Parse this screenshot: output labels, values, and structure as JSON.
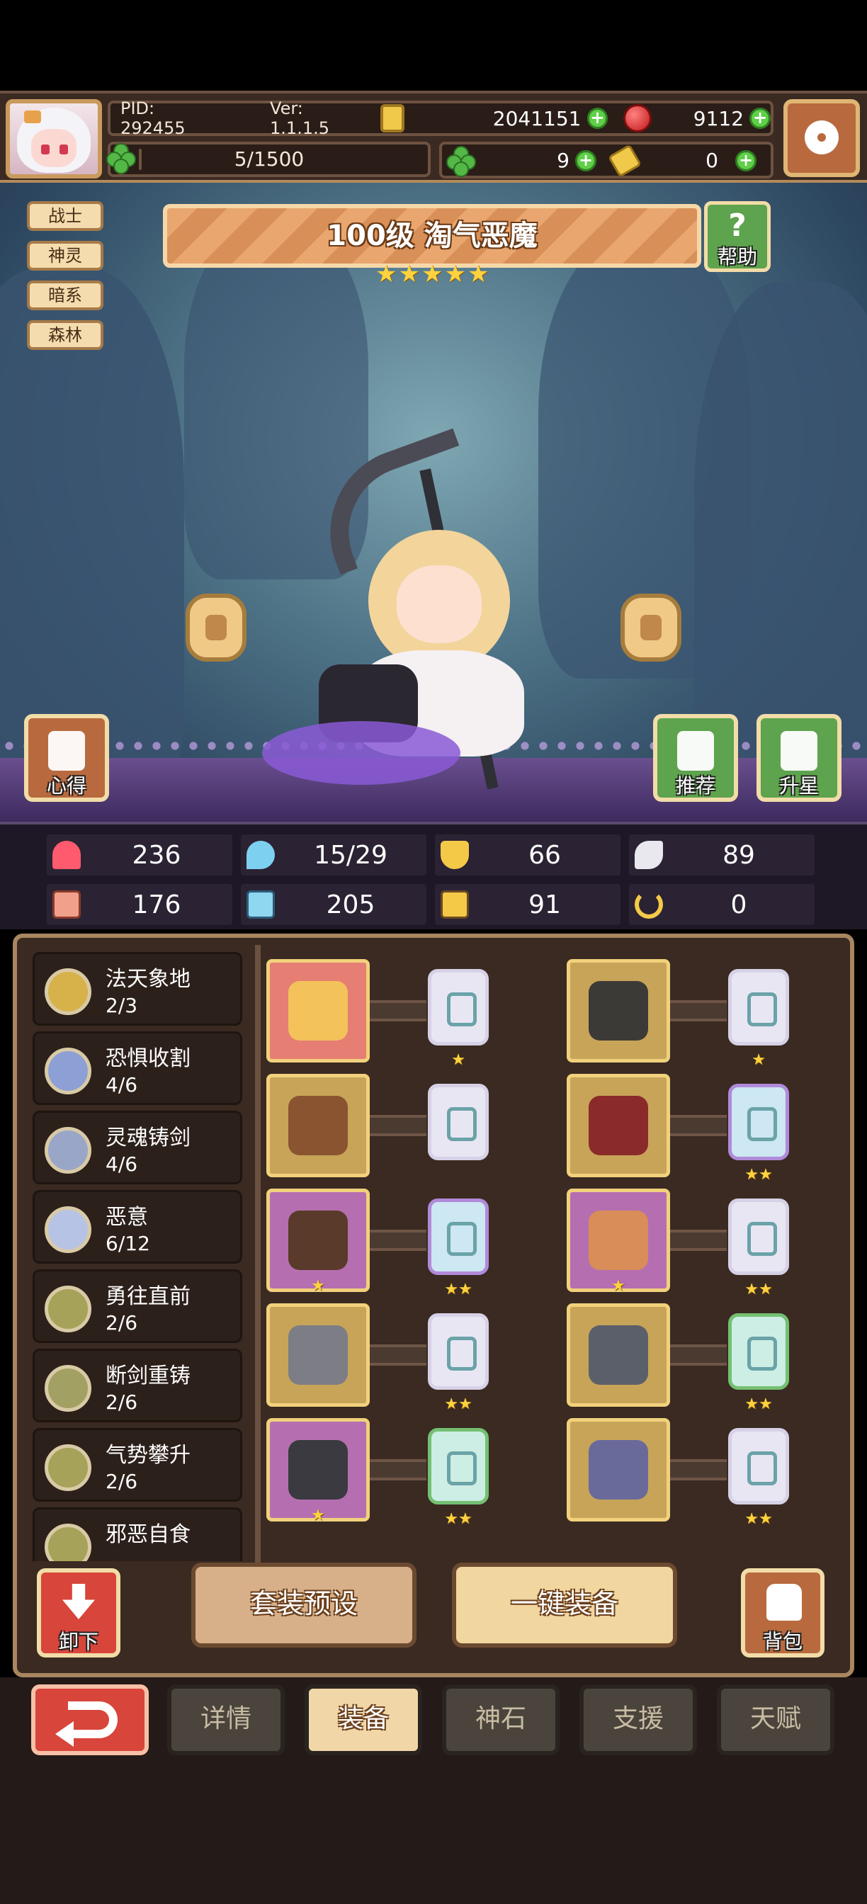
{
  "header": {
    "pid": "PID: 292455",
    "version": "Ver: 1.1.1.5",
    "gold": "2041151",
    "gems": "9112",
    "exp": "5/1500",
    "exp_fraction": 0.0033,
    "clover": "9",
    "scroll": "0"
  },
  "tags": [
    "战士",
    "神灵",
    "暗系",
    "森林"
  ],
  "hero": {
    "title": "100级  淘气恶魔",
    "stars": 5
  },
  "scene_buttons": {
    "help": "帮助",
    "insight": "心得",
    "recommend": "推荐",
    "star_up": "升星"
  },
  "stats": {
    "hp": "236",
    "mana": "15/29",
    "defense": "66",
    "speed": "89",
    "attack": "176",
    "magic": "205",
    "crit": "91",
    "luck": "0"
  },
  "sets": [
    {
      "name": "法天象地",
      "progress": "2/3"
    },
    {
      "name": "恐惧收割",
      "progress": "4/6"
    },
    {
      "name": "灵魂铸剑",
      "progress": "4/6"
    },
    {
      "name": "恶意",
      "progress": "6/12"
    },
    {
      "name": "勇往直前",
      "progress": "2/6"
    },
    {
      "name": "断剑重铸",
      "progress": "2/6"
    },
    {
      "name": "气势攀升",
      "progress": "2/6"
    },
    {
      "name": "邪恶自食",
      "progress": ""
    }
  ],
  "equipment_stars": {
    "row1_left_item": "",
    "row1_left_stone": "★",
    "row1_right_item": "",
    "row1_right_stone": "★",
    "row2_left_item": "",
    "row2_left_stone": "",
    "row2_right_item": "",
    "row2_right_stone": "★★",
    "row3_left_item": "★",
    "row3_left_stone": "★★",
    "row3_right_item": "★",
    "row3_right_stone": "★★",
    "row4_left_item": "",
    "row4_left_stone": "★★",
    "row4_right_item": "",
    "row4_right_stone": "★★",
    "row5_left_item": "★",
    "row5_left_stone": "★★",
    "row5_right_item": "",
    "row5_right_stone": "★★"
  },
  "actions": {
    "unequip": "卸下",
    "preset": "套装预设",
    "auto_equip": "一键装备",
    "bag": "背包"
  },
  "tabs": [
    "详情",
    "装备",
    "神石",
    "支援",
    "天赋"
  ],
  "active_tab": "装备"
}
